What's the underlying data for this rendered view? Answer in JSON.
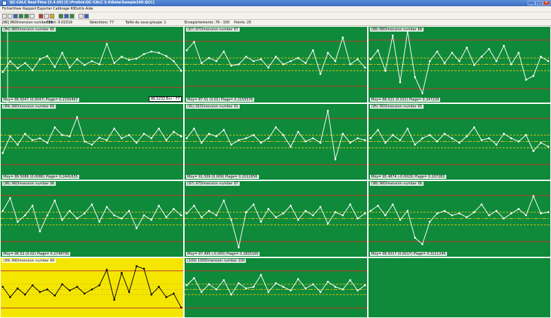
{
  "window": {
    "title": "QC-CALC Real-Time [3.4.60]   [C:\\Prolink\\QC-CALC 3.4\\Data\\Sample100.QCC]",
    "minimize": "_",
    "maximize": "□",
    "close": "✕"
  },
  "menu": [
    "Fichier",
    "View",
    "Rapport",
    "Exporter",
    "Calibrage RS",
    "Outils",
    "Aide"
  ],
  "toolbar_icons": [
    "open-icon",
    "save-icon",
    "print-icon",
    "chart-icon",
    "histogram-icon",
    "table-icon",
    "filter-icon",
    "zoom-icon",
    "lock-icon",
    "grid-icon",
    "refresh-icon",
    "gauge-icon",
    "settings-icon",
    "help-icon"
  ],
  "status": {
    "selection": "[86] 86Dimension number 86",
    "ecart": "Écart: 0.02319",
    "selections": "Sélections: 77",
    "subgroup": "Taille du sous-groupe: 1",
    "records": "Enregistrements: 76 - 100",
    "points": "Points: 25"
  },
  "colors": {
    "panel_bg": "#0f8a3a",
    "alarm_bg": "#f5e600",
    "control_limit": "#c0392b",
    "mean_line": "#d9c21a",
    "data_line": "#ffffff",
    "alarm_line": "#000000"
  },
  "panels": [
    {
      "id": "86",
      "title": "(86) 86Dimension number 86",
      "footer": "Moy= 86.5047 (0.0047) Plage= 0.2150497",
      "box": "86.5232 Enr - 77",
      "alarm": false,
      "chart_data": {
        "type": "line",
        "values": [
          0.38,
          0.55,
          0.44,
          0.52,
          0.41,
          0.58,
          0.63,
          0.46,
          0.68,
          0.45,
          0.58,
          0.49,
          0.55,
          0.5,
          0.82,
          0.52,
          0.62,
          0.57,
          0.59,
          0.66,
          0.7,
          0.68,
          0.63,
          0.55,
          0.4
        ],
        "ucl": 0.86,
        "lcl": 0.14,
        "mean": 0.5,
        "uwl": 0.6,
        "lwl": 0.4
      }
    },
    {
      "id": "87",
      "title": "(87) 87Dimension number 87",
      "footer": "Moy= 87.51 (0.01) Plage= 0.2155576",
      "box": "",
      "alarm": false,
      "chart_data": {
        "type": "line",
        "values": [
          0.72,
          0.85,
          0.52,
          0.6,
          0.55,
          0.7,
          0.48,
          0.5,
          0.62,
          0.55,
          0.58,
          0.45,
          0.62,
          0.5,
          0.55,
          0.6,
          0.52,
          0.72,
          0.35,
          0.68,
          0.55,
          0.92,
          0.5,
          0.58,
          0.45
        ],
        "ucl": 0.86,
        "lcl": 0.16,
        "mean": 0.5,
        "uwl": 0.6,
        "lwl": 0.4
      }
    },
    {
      "id": "88",
      "title": "(88) 88Dimension number 88",
      "footer": "Moy= 88.521 (0.021) Plage= 0.347229",
      "box": "",
      "alarm": false,
      "chart_data": {
        "type": "line",
        "values": [
          0.58,
          0.72,
          0.4,
          0.95,
          0.22,
          1.02,
          0.3,
          0.05,
          0.55,
          0.7,
          0.52,
          0.68,
          0.55,
          0.76,
          0.49,
          0.62,
          0.74,
          0.55,
          0.79,
          0.5,
          0.68,
          0.26,
          0.32,
          0.62,
          0.55
        ],
        "ucl": 0.88,
        "lcl": 0.12,
        "mean": 0.5,
        "uwl": 0.6,
        "lwl": 0.4
      }
    },
    {
      "id": "89",
      "title": "(89) 89Dimension number 89",
      "footer": "Moy= 89.5086 (0.0086) Plage= 0.2441635",
      "box": "",
      "alarm": false,
      "chart_data": {
        "type": "line",
        "values": [
          0.32,
          0.58,
          0.45,
          0.62,
          0.52,
          0.55,
          0.48,
          0.72,
          0.6,
          0.58,
          0.88,
          0.5,
          0.45,
          0.56,
          0.52,
          0.7,
          0.55,
          0.6,
          0.48,
          0.62,
          0.55,
          0.7,
          0.52,
          0.65,
          0.58
        ],
        "ucl": 0.86,
        "lcl": 0.14,
        "mean": 0.5,
        "uwl": 0.6,
        "lwl": 0.4
      }
    },
    {
      "id": "91",
      "title": "(91) 91Dimension number 91",
      "footer": "Moy= 91.509 (0.009) Plage= 0.2011856",
      "box": "",
      "alarm": false,
      "chart_data": {
        "type": "line",
        "values": [
          0.55,
          0.7,
          0.48,
          0.62,
          0.58,
          0.68,
          0.45,
          0.52,
          0.55,
          0.6,
          0.48,
          0.55,
          0.72,
          0.6,
          0.42,
          0.65,
          0.5,
          0.55,
          0.48,
          0.98,
          0.22,
          0.62,
          0.48,
          0.55,
          0.52
        ],
        "ucl": 0.86,
        "lcl": 0.14,
        "mean": 0.5,
        "uwl": 0.6,
        "lwl": 0.4
      }
    },
    {
      "id": "95",
      "title": "(95) 95Dimension number 95",
      "footer": "Moy= 95.4874 (-0.0026) Plage= 0.207283",
      "box": "",
      "alarm": false,
      "chart_data": {
        "type": "line",
        "values": [
          0.55,
          0.68,
          0.48,
          0.6,
          0.52,
          0.7,
          0.45,
          0.55,
          0.6,
          0.5,
          0.62,
          0.55,
          0.48,
          0.58,
          0.72,
          0.52,
          0.55,
          0.45,
          0.62,
          0.55,
          0.5,
          0.6,
          0.35,
          0.48,
          0.42
        ],
        "ucl": 0.86,
        "lcl": 0.14,
        "mean": 0.5,
        "uwl": 0.6,
        "lwl": 0.4
      }
    },
    {
      "id": "96",
      "title": "(96) 96Dimension number 96",
      "footer": "Moy= 96.52 (0.02) Plage= 0.2748795",
      "box": "",
      "alarm": false,
      "chart_data": {
        "type": "line",
        "values": [
          0.62,
          0.82,
          0.45,
          0.55,
          0.7,
          0.3,
          0.55,
          0.78,
          0.48,
          0.62,
          0.5,
          0.58,
          0.72,
          0.45,
          0.68,
          0.55,
          0.5,
          0.62,
          0.35,
          0.55,
          0.48,
          0.7,
          0.52,
          0.65,
          0.55
        ],
        "ucl": 0.86,
        "lcl": 0.14,
        "mean": 0.5,
        "uwl": 0.6,
        "lwl": 0.4
      }
    },
    {
      "id": "97",
      "title": "(97) 97Dimension number 97",
      "footer": "Moy= 97.495 (-0.005) Plage= 0.2825165",
      "box": "",
      "alarm": false,
      "chart_data": {
        "type": "line",
        "values": [
          0.58,
          0.7,
          0.52,
          0.62,
          0.55,
          0.78,
          0.48,
          0.05,
          0.6,
          0.72,
          0.45,
          0.65,
          0.52,
          0.58,
          0.7,
          0.48,
          0.62,
          0.55,
          0.68,
          0.42,
          0.6,
          0.55,
          0.72,
          0.5,
          0.58
        ],
        "ucl": 0.86,
        "lcl": 0.14,
        "mean": 0.5,
        "uwl": 0.6,
        "lwl": 0.4
      }
    },
    {
      "id": "98",
      "title": "(98) 98Dimension number 98",
      "footer": "Moy= 98.5017 (0.0017) Plage= 0.3211246",
      "box": "",
      "alarm": false,
      "chart_data": {
        "type": "line",
        "values": [
          0.62,
          0.7,
          0.55,
          0.72,
          0.48,
          0.62,
          0.2,
          0.1,
          0.45,
          0.58,
          0.62,
          0.55,
          0.58,
          0.52,
          0.6,
          0.72,
          0.55,
          0.62,
          0.5,
          0.58,
          0.65,
          0.55,
          0.85,
          0.58,
          0.6
        ],
        "ucl": 0.86,
        "lcl": 0.14,
        "mean": 0.5,
        "uwl": 0.6,
        "lwl": 0.4
      }
    },
    {
      "id": "99",
      "title": "(99) 99Dimension number 99",
      "footer": "",
      "box": "",
      "alarm": true,
      "chart_data": {
        "type": "line",
        "values": [
          0.55,
          0.35,
          0.52,
          0.4,
          0.58,
          0.45,
          0.5,
          0.38,
          0.6,
          0.48,
          0.55,
          0.42,
          0.5,
          0.58,
          0.88,
          0.3,
          0.82,
          0.45,
          0.95,
          0.9,
          0.4,
          0.55,
          0.35,
          0.42,
          0.15
        ],
        "ucl": 0.86,
        "lcl": 0.14,
        "mean": 0.5,
        "uwl": 0.6,
        "lwl": 0.4
      }
    },
    {
      "id": "100",
      "title": "(100) 100Dimension number 100",
      "footer": "",
      "box": "",
      "alarm": false,
      "chart_data": {
        "type": "line",
        "values": [
          0.58,
          0.72,
          0.45,
          0.6,
          0.5,
          0.68,
          0.4,
          0.62,
          0.52,
          0.55,
          0.78,
          0.45,
          0.62,
          0.55,
          0.48,
          0.7,
          0.52,
          0.6,
          0.45,
          0.65,
          0.55,
          0.5,
          0.68,
          0.48,
          0.58
        ],
        "ucl": 0.86,
        "lcl": 0.14,
        "mean": 0.5,
        "uwl": 0.6,
        "lwl": 0.4
      }
    }
  ]
}
